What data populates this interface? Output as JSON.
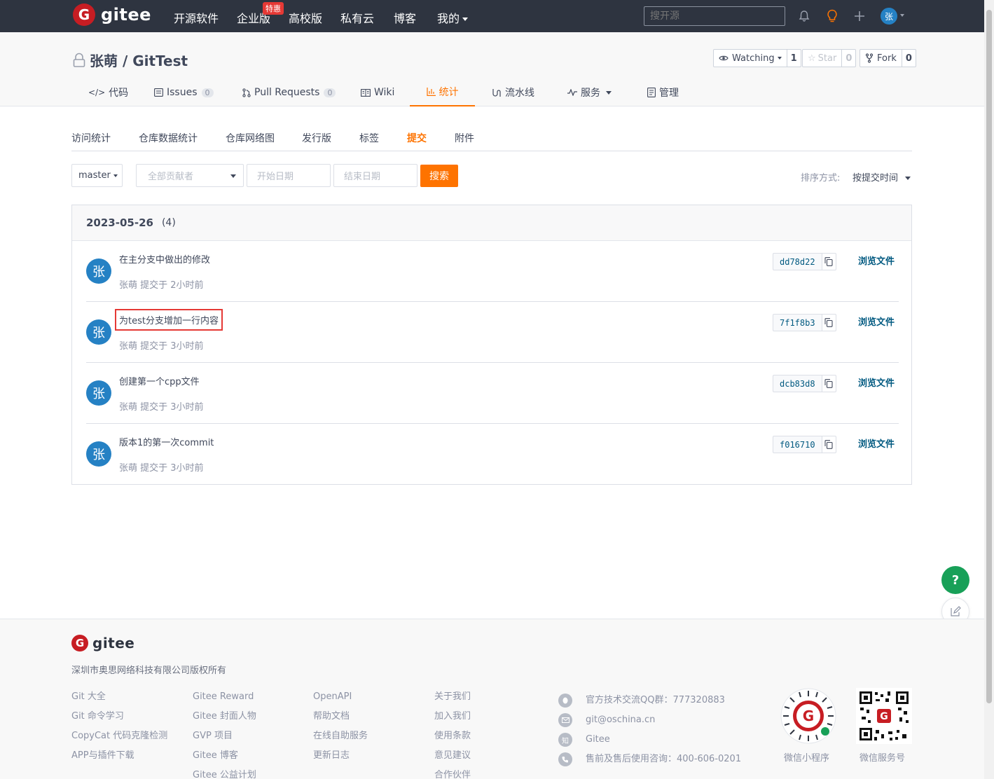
{
  "topnav": {
    "logo_text": "gitee",
    "items": [
      "开源软件",
      "企业版",
      "高校版",
      "私有云",
      "博客",
      "我的"
    ],
    "enterprise_badge": "特惠",
    "search_placeholder": "搜开源",
    "avatar_letter": "张"
  },
  "repo": {
    "title": "张萌 / GitTest",
    "watching_label": "Watching",
    "watching_count": "1",
    "star_label": "Star",
    "star_count": "0",
    "fork_label": "Fork",
    "fork_count": "0"
  },
  "repo_tabs": [
    {
      "label": "代码"
    },
    {
      "label": "Issues",
      "count": "0"
    },
    {
      "label": "Pull Requests",
      "count": "0"
    },
    {
      "label": "Wiki"
    },
    {
      "label": "统计"
    },
    {
      "label": "流水线"
    },
    {
      "label": "服务"
    },
    {
      "label": "管理"
    }
  ],
  "active_repo_tab": "统计",
  "sub_tabs": [
    "访问统计",
    "仓库数据统计",
    "仓库网络图",
    "发行版",
    "标签",
    "提交",
    "附件"
  ],
  "active_sub_tab": "提交",
  "filters": {
    "branch": "master",
    "contributor_placeholder": "全部贡献者",
    "start_placeholder": "开始日期",
    "end_placeholder": "结束日期",
    "search_button": "搜索",
    "sort_label": "排序方式:",
    "sort_value": "按提交时间"
  },
  "commit_group": {
    "date": "2023-05-26",
    "count": "(4)",
    "commits": [
      {
        "avatar": "张",
        "message": "在主分支中做出的修改",
        "meta": "张萌 提交于 2小时前",
        "sha": "dd78d22",
        "browse": "浏览文件",
        "highlighted": false
      },
      {
        "avatar": "张",
        "message": "为test分支增加一行内容",
        "meta": "张萌 提交于 3小时前",
        "sha": "7f1f8b3",
        "browse": "浏览文件",
        "highlighted": true
      },
      {
        "avatar": "张",
        "message": "创建第一个cpp文件",
        "meta": "张萌 提交于 3小时前",
        "sha": "dcb83d8",
        "browse": "浏览文件",
        "highlighted": false
      },
      {
        "avatar": "张",
        "message": "版本1的第一次commit",
        "meta": "张萌 提交于 3小时前",
        "sha": "f016710",
        "browse": "浏览文件",
        "highlighted": false
      }
    ]
  },
  "fab": {
    "help": "?"
  },
  "footer": {
    "logo_text": "gitee",
    "copyright": "深圳市奥思网络科技有限公司版权所有",
    "col1": [
      "Git 大全",
      "Git 命令学习",
      "CopyCat 代码克隆检测",
      "APP与插件下载"
    ],
    "col2": [
      "Gitee Reward",
      "Gitee 封面人物",
      "GVP 项目",
      "Gitee 博客",
      "Gitee 公益计划"
    ],
    "col3": [
      "OpenAPI",
      "帮助文档",
      "在线自助服务",
      "更新日志"
    ],
    "col4": [
      "关于我们",
      "加入我们",
      "使用条款",
      "意见建议",
      "合作伙伴"
    ],
    "contacts": [
      {
        "icon": "qq-icon",
        "text": "官方技术交流QQ群：777320883"
      },
      {
        "icon": "mail-icon",
        "text": "git@oschina.cn"
      },
      {
        "icon": "zhihu-icon",
        "text": "Gitee",
        "glyph": "知"
      },
      {
        "icon": "phone-icon",
        "text": "售前及售后使用咨询：400-606-0201"
      }
    ],
    "qr_mini": "微信小程序",
    "qr_service": "微信服务号"
  },
  "colors": {
    "accent": "#fe7300",
    "nav_bg": "#2e3440",
    "link": "#005980",
    "brand_red": "#c71d23",
    "highlight_box": "#e53935"
  }
}
